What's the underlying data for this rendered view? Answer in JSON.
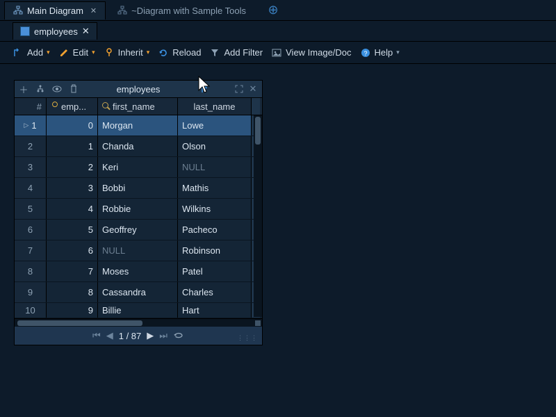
{
  "topTabs": {
    "main": "Main Diagram",
    "sample": "~Diagram with Sample Tools"
  },
  "subTab": {
    "label": "employees"
  },
  "toolbar": {
    "add": "Add",
    "edit": "Edit",
    "inherit": "Inherit",
    "reload": "Reload",
    "addFilter": "Add Filter",
    "viewImage": "View Image/Doc",
    "help": "Help"
  },
  "panel": {
    "title": "employees",
    "columns": {
      "idx": "#",
      "emp": "emp...",
      "first": "first_name",
      "last": "last_name"
    },
    "rows": [
      {
        "idx": "1",
        "id": "0",
        "first": "Morgan",
        "last": "Lowe",
        "selected": true,
        "play": true
      },
      {
        "idx": "2",
        "id": "1",
        "first": "Chanda",
        "last": "Olson"
      },
      {
        "idx": "3",
        "id": "2",
        "first": "Keri",
        "last": "NULL",
        "lastNull": true
      },
      {
        "idx": "4",
        "id": "3",
        "first": "Bobbi",
        "last": "Mathis"
      },
      {
        "idx": "5",
        "id": "4",
        "first": "Robbie",
        "last": "Wilkins"
      },
      {
        "idx": "6",
        "id": "5",
        "first": "Geoffrey",
        "last": "Pacheco"
      },
      {
        "idx": "7",
        "id": "6",
        "first": "NULL",
        "last": "Robinson",
        "firstNull": true
      },
      {
        "idx": "8",
        "id": "7",
        "first": "Moses",
        "last": "Patel"
      },
      {
        "idx": "9",
        "id": "8",
        "first": "Cassandra",
        "last": "Charles"
      },
      {
        "idx": "10",
        "id": "9",
        "first": "Billie",
        "last": "Hart",
        "partial": true
      }
    ],
    "pager": "1 / 87"
  }
}
